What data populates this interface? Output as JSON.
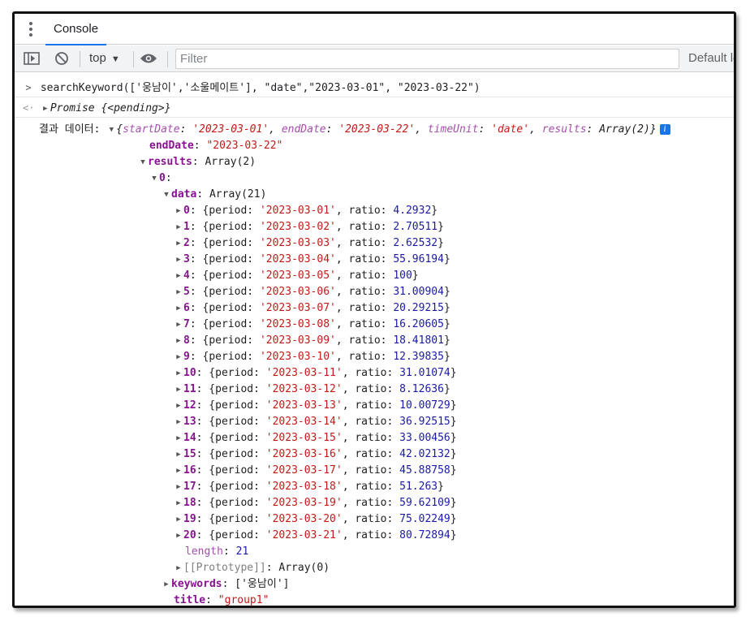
{
  "tab": {
    "console_label": "Console"
  },
  "toolbar": {
    "context_label": "top",
    "filter_placeholder": "Filter",
    "levels_label": "Default le"
  },
  "input": {
    "command": "searchKeyword(['웅남이','소울메이트'], \"date\",\"2023-03-01\", \"2023-03-22\")"
  },
  "promise": {
    "text": "Promise {<pending>}"
  },
  "result": {
    "label": "결과 데이터:",
    "summary_open": "{",
    "k_startDate": "startDate",
    "v_startDate": "'2023-03-01'",
    "k_endDate": "endDate",
    "v_endDate": "'2023-03-22'",
    "k_timeUnit": "timeUnit",
    "v_timeUnit": "'date'",
    "k_results": "results",
    "v_results": "Array(2)",
    "summary_close": "}",
    "endDate_key": "endDate",
    "endDate_val": "\"2023-03-22\"",
    "results_key": "results",
    "results_val": "Array(2)",
    "item0_key": "0",
    "data_key": "data",
    "data_val": "Array(21)",
    "rows": [
      {
        "i": "0",
        "period": "'2023-03-01'",
        "ratio": "4.2932"
      },
      {
        "i": "1",
        "period": "'2023-03-02'",
        "ratio": "2.70511"
      },
      {
        "i": "2",
        "period": "'2023-03-03'",
        "ratio": "2.62532"
      },
      {
        "i": "3",
        "period": "'2023-03-04'",
        "ratio": "55.96194"
      },
      {
        "i": "4",
        "period": "'2023-03-05'",
        "ratio": "100"
      },
      {
        "i": "5",
        "period": "'2023-03-06'",
        "ratio": "31.00904"
      },
      {
        "i": "6",
        "period": "'2023-03-07'",
        "ratio": "20.29215"
      },
      {
        "i": "7",
        "period": "'2023-03-08'",
        "ratio": "16.20605"
      },
      {
        "i": "8",
        "period": "'2023-03-09'",
        "ratio": "18.41801"
      },
      {
        "i": "9",
        "period": "'2023-03-10'",
        "ratio": "12.39835"
      },
      {
        "i": "10",
        "period": "'2023-03-11'",
        "ratio": "31.01074"
      },
      {
        "i": "11",
        "period": "'2023-03-12'",
        "ratio": "8.12636"
      },
      {
        "i": "12",
        "period": "'2023-03-13'",
        "ratio": "10.00729"
      },
      {
        "i": "13",
        "period": "'2023-03-14'",
        "ratio": "36.92515"
      },
      {
        "i": "14",
        "period": "'2023-03-15'",
        "ratio": "33.00456"
      },
      {
        "i": "15",
        "period": "'2023-03-16'",
        "ratio": "42.02132"
      },
      {
        "i": "16",
        "period": "'2023-03-17'",
        "ratio": "45.88758"
      },
      {
        "i": "17",
        "period": "'2023-03-18'",
        "ratio": "51.263"
      },
      {
        "i": "18",
        "period": "'2023-03-19'",
        "ratio": "59.62109"
      },
      {
        "i": "19",
        "period": "'2023-03-20'",
        "ratio": "75.02249"
      },
      {
        "i": "20",
        "period": "'2023-03-21'",
        "ratio": "80.72894"
      }
    ],
    "row_period_key": "period",
    "row_ratio_key": "ratio",
    "length_key": "length",
    "length_val": "21",
    "proto_key": "[[Prototype]]",
    "proto_val": "Array(0)",
    "keywords_key": "keywords",
    "keywords_val": "['웅남이']",
    "title_key": "title",
    "title_val": "\"group1\""
  }
}
